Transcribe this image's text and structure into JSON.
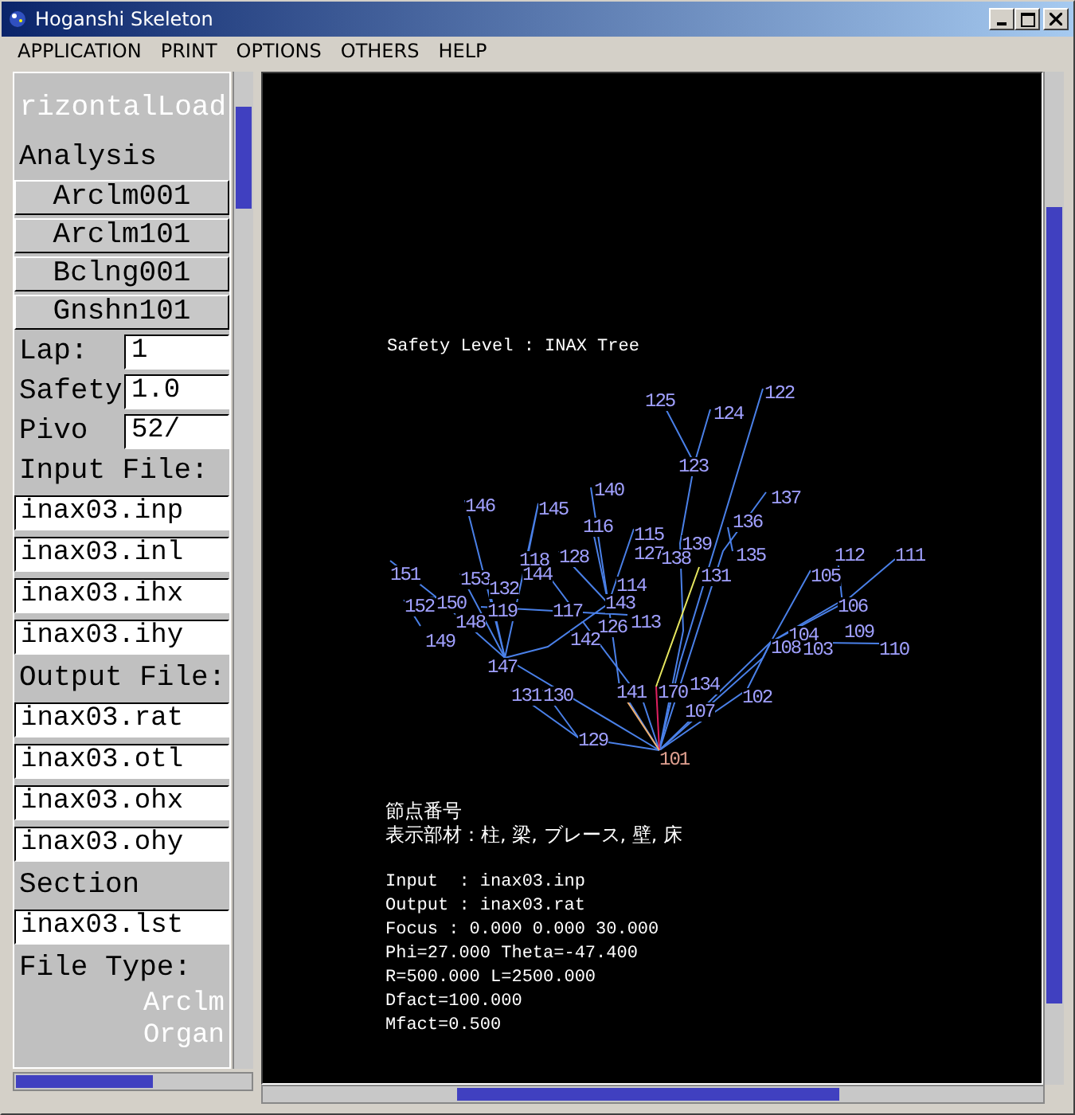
{
  "window": {
    "title": "Hoganshi Skeleton"
  },
  "menu": [
    "APPLICATION",
    "PRINT",
    "OPTIONS",
    "OTHERS",
    "HELP"
  ],
  "side_panel": {
    "header_lines": [
      "rizontalLoad"
    ],
    "analysis_label": "Analysis",
    "analysis_buttons": [
      "Arclm001",
      "Arclm101",
      "Bclng001",
      "Gnshn101"
    ],
    "fields": [
      {
        "label": "Lap:",
        "value": "1"
      },
      {
        "label": "Safety",
        "value": "1.0"
      },
      {
        "label": "Pivo",
        "value": "52/"
      }
    ],
    "input_label": "Input File:",
    "input_files": [
      "inax03.inp",
      "inax03.inl",
      "inax03.ihx",
      "inax03.ihy"
    ],
    "output_label": "Output File:",
    "output_files": [
      "inax03.rat",
      "inax03.otl",
      "inax03.ohx",
      "inax03.ohy"
    ],
    "section_label": "Section",
    "section_files": [
      "inax03.lst"
    ],
    "file_type_label": "File Type:",
    "file_types": [
      "Arclm",
      "Organ"
    ]
  },
  "canvas": {
    "title": "Safety Level : INAX Tree",
    "nodes": [
      {
        "label": "125"
      },
      {
        "label": "122"
      },
      {
        "label": "124"
      },
      {
        "label": "123"
      },
      {
        "label": "140"
      },
      {
        "label": "137"
      },
      {
        "label": "146"
      },
      {
        "label": "145"
      },
      {
        "label": "116"
      },
      {
        "label": "136"
      },
      {
        "label": "115"
      },
      {
        "label": "139"
      },
      {
        "label": "118"
      },
      {
        "label": "128"
      },
      {
        "label": "127"
      },
      {
        "label": "138"
      },
      {
        "label": "135"
      },
      {
        "label": "112"
      },
      {
        "label": "111"
      },
      {
        "label": "151"
      },
      {
        "label": "153"
      },
      {
        "label": "144"
      },
      {
        "label": "131"
      },
      {
        "label": "105"
      },
      {
        "label": "132"
      },
      {
        "label": "114"
      },
      {
        "label": "152"
      },
      {
        "label": "150"
      },
      {
        "label": "119"
      },
      {
        "label": "117"
      },
      {
        "label": "143"
      },
      {
        "label": "106"
      },
      {
        "label": "148"
      },
      {
        "label": "126"
      },
      {
        "label": "113"
      },
      {
        "label": "149"
      },
      {
        "label": "142"
      },
      {
        "label": "104"
      },
      {
        "label": "109"
      },
      {
        "label": "108"
      },
      {
        "label": "103"
      },
      {
        "label": "110"
      },
      {
        "label": "147"
      },
      {
        "label": "141"
      },
      {
        "label": "170"
      },
      {
        "label": "134"
      },
      {
        "label": "131"
      },
      {
        "label": "130"
      },
      {
        "label": "102"
      },
      {
        "label": "107"
      },
      {
        "label": "129"
      },
      {
        "label": "101"
      }
    ],
    "legend": [
      "節点番号",
      "表示部材：柱, 梁, ブレース, 壁, 床"
    ],
    "info_lines": [
      "Input  : inax03.inp",
      "Output : inax03.rat",
      "Focus : 0.000 0.000 30.000",
      "Phi=27.000 Theta=-47.400",
      "R=500.000 L=2500.000",
      "Dfact=100.000",
      "Mfact=0.500"
    ]
  }
}
